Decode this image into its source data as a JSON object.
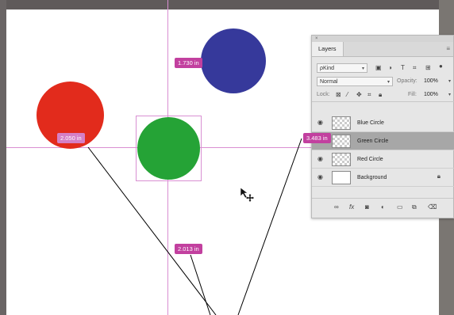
{
  "measurements": {
    "top": "1.730 in",
    "left": "2.050 in",
    "bottom": "2.013 in",
    "right": "3.483 in"
  },
  "colors": {
    "red_circle": "#e22b1c",
    "green_circle": "#25a336",
    "blue_circle": "#36399b",
    "guide": "#d98fd2",
    "badge": "#c2409f"
  },
  "layers_panel": {
    "close_glyph": "×",
    "tab_label": "Layers",
    "menu_icon": "≡",
    "filter": {
      "prefix": "ρ",
      "value": "Kind"
    },
    "blend_mode": "Normal",
    "opacity_label": "Opacity:",
    "opacity_value": "100%",
    "lock_label": "Lock:",
    "fill_label": "Fill:",
    "fill_value": "100%",
    "layers": [
      {
        "name": "Blue Circle",
        "visible": true,
        "selected": false
      },
      {
        "name": "Green Circle",
        "visible": true,
        "selected": true
      },
      {
        "name": "Red Circle",
        "visible": true,
        "selected": false
      },
      {
        "name": "Background",
        "visible": true,
        "selected": false,
        "locked": true
      }
    ],
    "bottom_icons": [
      "link-icon",
      "fx-icon",
      "mask-icon",
      "adjustment-icon",
      "folder-icon",
      "new-layer-icon",
      "trash-icon"
    ],
    "fx_label": "fx"
  }
}
